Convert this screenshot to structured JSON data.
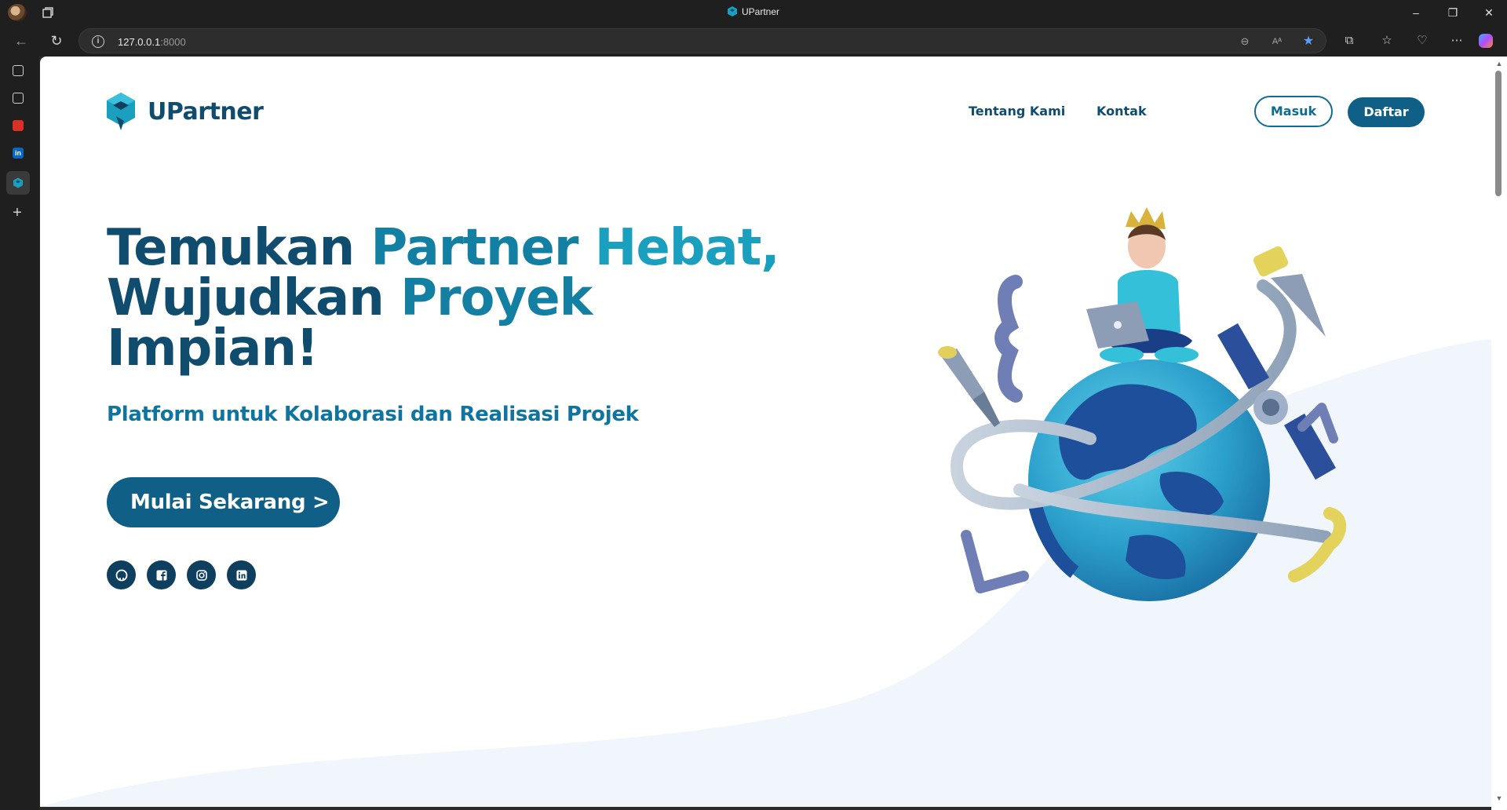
{
  "browser": {
    "tab_title": "UPartner",
    "url_host": "127.0.0.1",
    "url_port": ":8000",
    "window_controls": [
      "minimize-icon",
      "restore-icon",
      "close-icon"
    ],
    "toolbar_icons": [
      "zoom-out-icon",
      "read-aloud-icon",
      "favorite-star-icon",
      "extensions-icon",
      "favorites-icon",
      "browser-essentials-icon",
      "more-icon",
      "copilot-icon"
    ]
  },
  "sidebar": {
    "icons": [
      "tab-actions-icon",
      "collections-icon",
      "pdf-icon",
      "linkedin-icon",
      "upartner-icon",
      "add-icon"
    ]
  },
  "header": {
    "brand": "UPartner",
    "nav": [
      {
        "label": "Tentang Kami"
      },
      {
        "label": "Kontak"
      }
    ],
    "login_label": "Masuk",
    "register_label": "Daftar"
  },
  "hero": {
    "line1_a": "Temukan ",
    "line1_b": "Partner ",
    "line1_c": "Hebat,",
    "line2_a": "Wujudkan ",
    "line2_b": "Proyek",
    "line3": "Impian!",
    "subtitle": "Platform untuk Kolaborasi dan Realisasi Projek",
    "cta_label": "Mulai Sekarang >"
  },
  "socials": [
    "github-icon",
    "facebook-icon",
    "instagram-icon",
    "linkedin-icon"
  ],
  "colors": {
    "primary": "#0f4c6e",
    "accent": "#127fa3",
    "accent_light": "#1a9fbf",
    "button": "#0f5f86",
    "wave": "#f1f6fc"
  }
}
